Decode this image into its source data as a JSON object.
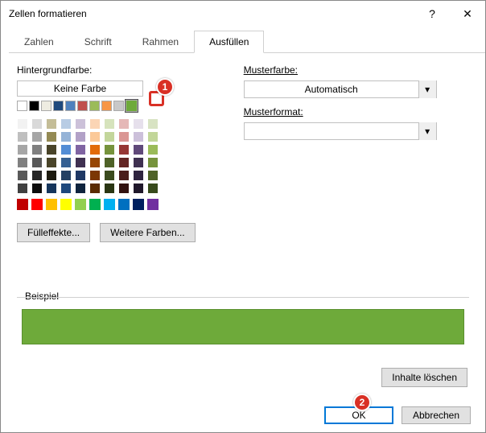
{
  "window": {
    "title": "Zellen formatieren",
    "help_glyph": "?",
    "close_glyph": "✕"
  },
  "tabs": {
    "t0": "Zahlen",
    "t1": "Schrift",
    "t2": "Rahmen",
    "t3": "Ausfüllen"
  },
  "left": {
    "bg_label": "Hintergrundfarbe:",
    "no_color": "Keine Farbe",
    "fill_effects": "Fülleffekte...",
    "more_colors": "Weitere Farben..."
  },
  "right": {
    "musterfarbe": "Musterfarbe:",
    "musterfarbe_val": "Automatisch",
    "musterformat": "Musterformat:",
    "musterformat_val": ""
  },
  "example": {
    "label": "Beispiel"
  },
  "buttons": {
    "clear": "Inhalte löschen",
    "ok": "OK",
    "cancel": "Abbrechen"
  },
  "callouts": {
    "one": "1",
    "two": "2"
  },
  "row1_colors": [
    "#ffffff",
    "#000000",
    "#eeece1",
    "#1f497d",
    "#4f81bd",
    "#c0504d",
    "#9bbb59",
    "#f79646",
    "#c8c8c8",
    "#2a8dd4"
  ],
  "theme_grid": [
    "#f2f2f2",
    "#d9d9d9",
    "#c4bd97",
    "#b8cce4",
    "#ccc1d9",
    "#fbd5b5",
    "#d6e3bc",
    "#e5b8b7",
    "#e6e0ec",
    "#d8e3c3",
    "#bfbfbf",
    "#a6a6a6",
    "#948a54",
    "#95b3d7",
    "#b2a1c7",
    "#fbc999",
    "#c3d69b",
    "#da9694",
    "#ccc0da",
    "#c2d699",
    "#a6a6a6",
    "#808080",
    "#494429",
    "#538dd5",
    "#8064a2",
    "#e26b0a",
    "#76933c",
    "#963634",
    "#60497a",
    "#9bbb59",
    "#808080",
    "#595959",
    "#4a452a",
    "#366092",
    "#403151",
    "#974706",
    "#4f6228",
    "#632523",
    "#3f3151",
    "#76933c",
    "#595959",
    "#262626",
    "#1d1b10",
    "#244062",
    "#1f3864",
    "#7b3705",
    "#3b4b1e",
    "#4a1d1b",
    "#2f2440",
    "#4f6228",
    "#404040",
    "#0d0d0d",
    "#16365c",
    "#1f497d",
    "#0f243e",
    "#5a2c04",
    "#2a3613",
    "#321311",
    "#20182b",
    "#384a1c"
  ],
  "standard_colors": [
    "#c00000",
    "#ff0000",
    "#ffc000",
    "#ffff00",
    "#92d050",
    "#00b050",
    "#00b0f0",
    "#0070c0",
    "#002060",
    "#7030a0"
  ]
}
